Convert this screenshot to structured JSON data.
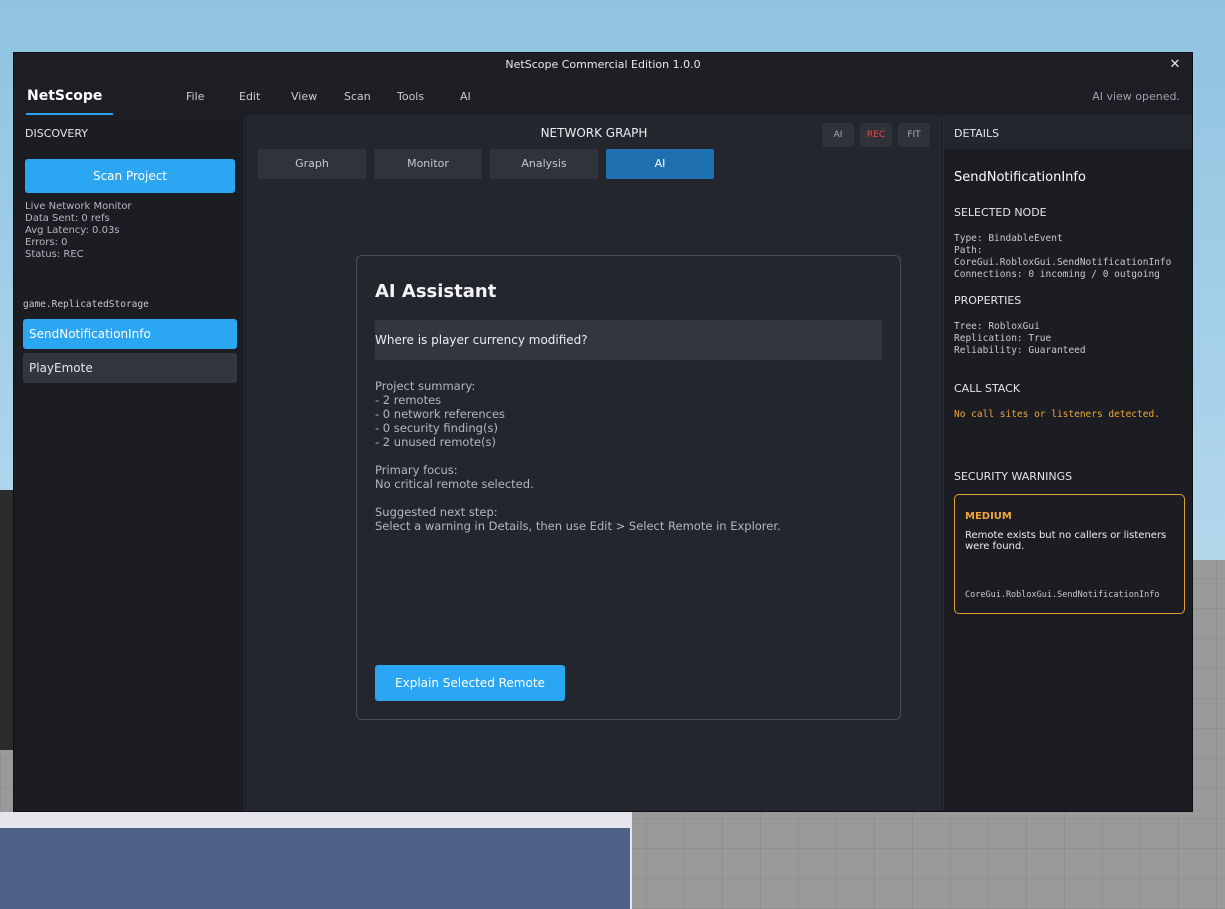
{
  "window": {
    "title": "NetScope Commercial Edition 1.0.0",
    "close_glyph": "✕"
  },
  "menubar": {
    "brand": "NetScope",
    "items": [
      "File",
      "Edit",
      "View",
      "Scan",
      "Tools",
      "AI"
    ],
    "status": "AI view opened."
  },
  "sidebar": {
    "header": "DISCOVERY",
    "scan_button": "Scan Project",
    "monitor": {
      "title": "Live Network Monitor",
      "data_sent": "Data Sent: 0 refs",
      "avg_latency": "Avg Latency: 0.03s",
      "errors": "Errors: 0",
      "status": "Status: REC"
    },
    "tree_path": "game.ReplicatedStorage",
    "remotes": [
      {
        "label": "SendNotificationInfo",
        "selected": true
      },
      {
        "label": "PlayEmote",
        "selected": false
      }
    ]
  },
  "center": {
    "title": "NETWORK GRAPH",
    "graph_buttons": {
      "ai": "AI",
      "rec": "REC",
      "fit": "FIT"
    },
    "tabs": [
      {
        "label": "Graph",
        "active": false
      },
      {
        "label": "Monitor",
        "active": false
      },
      {
        "label": "Analysis",
        "active": false
      },
      {
        "label": "AI",
        "active": true
      }
    ],
    "ai_panel": {
      "title": "AI Assistant",
      "query": "Where is player currency modified?",
      "answer": "Project summary:\n- 2 remotes\n- 0 network references\n- 0 security finding(s)\n- 2 unused remote(s)\n\nPrimary focus:\nNo critical remote selected.\n\nSuggested next step:\nSelect a warning in Details, then use Edit > Select Remote in Explorer.",
      "explain_button": "Explain Selected Remote"
    }
  },
  "details": {
    "header": "DETAILS",
    "node_name": "SendNotificationInfo",
    "selected_node_label": "SELECTED NODE",
    "node_info": {
      "type": "Type: BindableEvent",
      "path_label": "Path:",
      "path": "CoreGui.RobloxGui.SendNotificationInfo",
      "connections": "Connections: 0 incoming / 0 outgoing"
    },
    "properties_label": "PROPERTIES",
    "properties": {
      "tree": "Tree: RobloxGui",
      "replication": "Replication: True",
      "reliability": "Reliability: Guaranteed"
    },
    "call_stack_label": "CALL STACK",
    "call_stack_message": "No call sites or listeners detected.",
    "security_label": "SECURITY WARNINGS",
    "warning": {
      "severity": "MEDIUM",
      "message": "Remote exists but no callers or listeners were found.",
      "path": "CoreGui.RobloxGui.SendNotificationInfo"
    }
  },
  "colors": {
    "accent": "#2ba6f3",
    "active_tab": "#1d6fb0",
    "warning": "#f1a53a",
    "rec": "#e04848"
  }
}
